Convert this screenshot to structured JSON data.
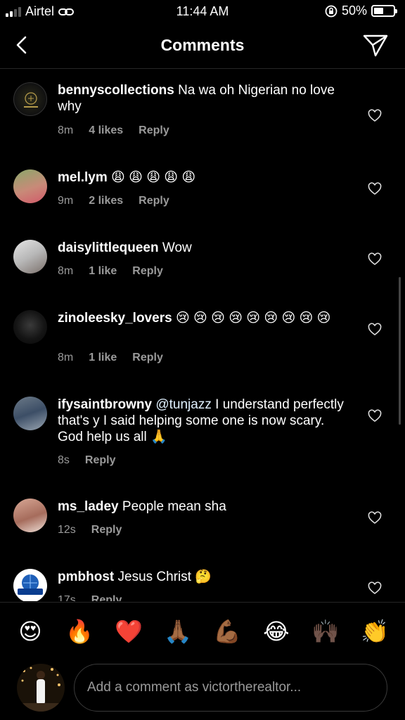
{
  "status_bar": {
    "carrier": "Airtel",
    "time": "11:44 AM",
    "battery": "50%"
  },
  "header": {
    "title": "Comments"
  },
  "comments": [
    {
      "user": "bennyscollections",
      "text": "Na wa oh Nigerian no love why",
      "time": "8m",
      "likes": "4 likes",
      "reply": "Reply"
    },
    {
      "user": "mel.lym",
      "text": "😩 😩 😩 😩 😩",
      "time": "9m",
      "likes": "2 likes",
      "reply": "Reply"
    },
    {
      "user": "daisylittlequeen",
      "text": "Wow",
      "time": "8m",
      "likes": "1 like",
      "reply": "Reply"
    },
    {
      "user": "zinoleesky_lovers",
      "text": "😢 😢 😢 😢 😢 😢 😢 😢 😢",
      "time": "8m",
      "likes": "1 like",
      "reply": "Reply"
    },
    {
      "user": "ifysaintbrowny",
      "mention": "@tunjazz",
      "text": "I understand perfectly that's y I said helping some one is now scary. God help us all 🙏",
      "time": "8s",
      "likes": "",
      "reply": "Reply"
    },
    {
      "user": "ms_ladey",
      "text": "People mean sha",
      "time": "12s",
      "likes": "",
      "reply": "Reply"
    },
    {
      "user": "pmbhost",
      "text": "Jesus Christ 🤔",
      "time": "17s",
      "likes": "",
      "reply": "Reply"
    }
  ],
  "reactions": [
    "😍",
    "🔥",
    "❤️",
    "🙏🏾",
    "💪🏾",
    "😂",
    "🙌🏿",
    "👏"
  ],
  "composer": {
    "placeholder": "Add a comment as victortherealtor..."
  },
  "colors": {
    "background": "#000000",
    "secondary_text": "#9a9a9a",
    "mention": "#e0f1ff"
  }
}
